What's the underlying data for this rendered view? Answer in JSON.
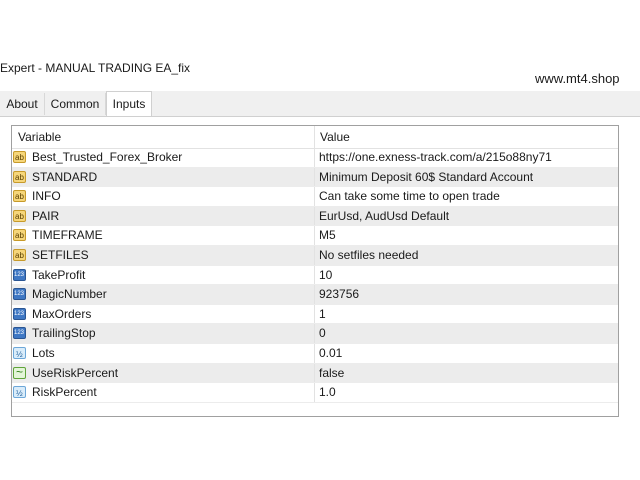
{
  "window": {
    "title": "Expert - MANUAL TRADING EA_fix"
  },
  "watermark": "www.mt4.shop",
  "tabs": [
    {
      "label": "About",
      "active": false
    },
    {
      "label": "Common",
      "active": false
    },
    {
      "label": "Inputs",
      "active": true
    }
  ],
  "table": {
    "headers": {
      "variable": "Variable",
      "value": "Value"
    },
    "rows": [
      {
        "variable": "Best_Trusted_Forex_Broker",
        "value": "https://one.exness-track.com/a/215o88ny71",
        "icon": "string-icon"
      },
      {
        "variable": "STANDARD",
        "value": "Minimum Deposit 60$ Standard Account",
        "icon": "string-icon"
      },
      {
        "variable": "INFO",
        "value": "Can take some time to open trade",
        "icon": "string-icon"
      },
      {
        "variable": "PAIR",
        "value": "EurUsd, AudUsd Default",
        "icon": "string-icon"
      },
      {
        "variable": "TIMEFRAME",
        "value": "M5",
        "icon": "string-icon"
      },
      {
        "variable": "SETFILES",
        "value": "No setfiles needed",
        "icon": "string-icon"
      },
      {
        "variable": "TakeProfit",
        "value": "10",
        "icon": "integer-icon"
      },
      {
        "variable": "MagicNumber",
        "value": "923756",
        "icon": "integer-icon"
      },
      {
        "variable": "MaxOrders",
        "value": "1",
        "icon": "integer-icon"
      },
      {
        "variable": "TrailingStop",
        "value": "0",
        "icon": "integer-icon"
      },
      {
        "variable": "Lots",
        "value": "0.01",
        "icon": "double-icon"
      },
      {
        "variable": "UseRiskPercent",
        "value": "false",
        "icon": "bool-icon"
      },
      {
        "variable": "RiskPercent",
        "value": "1.0",
        "icon": "double-icon"
      }
    ]
  }
}
